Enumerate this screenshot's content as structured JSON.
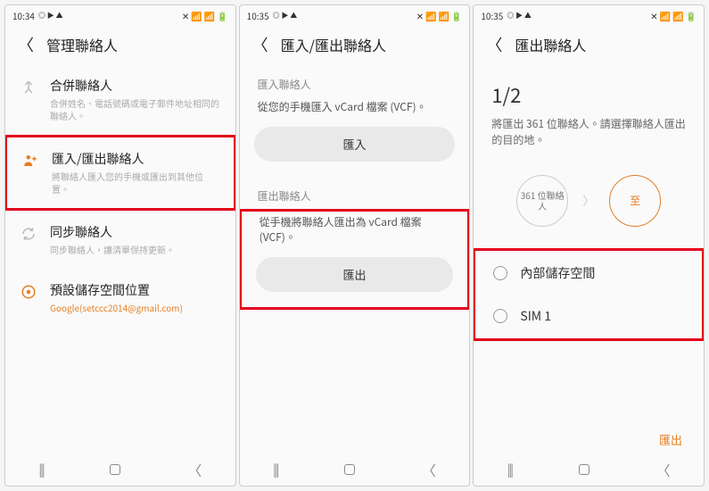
{
  "status": {
    "time1": "10:34",
    "time2": "10:35",
    "time3": "10:35",
    "icons_left": "◎ ▶ ▲",
    "icons_right": "📶 📶 🔋"
  },
  "screen1": {
    "title": "管理聯絡人",
    "items": [
      {
        "icon": "merge",
        "label": "合併聯絡人",
        "sub": "合併姓名、電話號碼或電子郵件地址相同的聯絡人。"
      },
      {
        "icon": "import",
        "label": "匯入/匯出聯絡人",
        "sub": "將聯絡人匯入您的手機或匯出到其他位置。"
      },
      {
        "icon": "sync",
        "label": "同步聯絡人",
        "sub": "同步聯絡人，讓清單保持更新。"
      },
      {
        "icon": "storage",
        "label": "預設儲存空間位置",
        "sub": "Google(setccc2014@gmail.com)"
      }
    ]
  },
  "screen2": {
    "title": "匯入/匯出聯絡人",
    "import_section": "匯入聯絡人",
    "import_desc": "從您的手機匯入 vCard 檔案 (VCF)。",
    "import_btn": "匯入",
    "export_section": "匯出聯絡人",
    "export_desc": "從手機將聯絡人匯出為 vCard 檔案 (VCF)。",
    "export_btn": "匯出"
  },
  "screen3": {
    "title": "匯出聯絡人",
    "step": "1/2",
    "desc": "將匯出 361 位聯絡人。請選擇聯絡人匯出的目的地。",
    "circle_from": "361 位聯絡人",
    "circle_to": "至",
    "options": [
      "內部儲存空間",
      "SIM 1"
    ],
    "action": "匯出"
  }
}
